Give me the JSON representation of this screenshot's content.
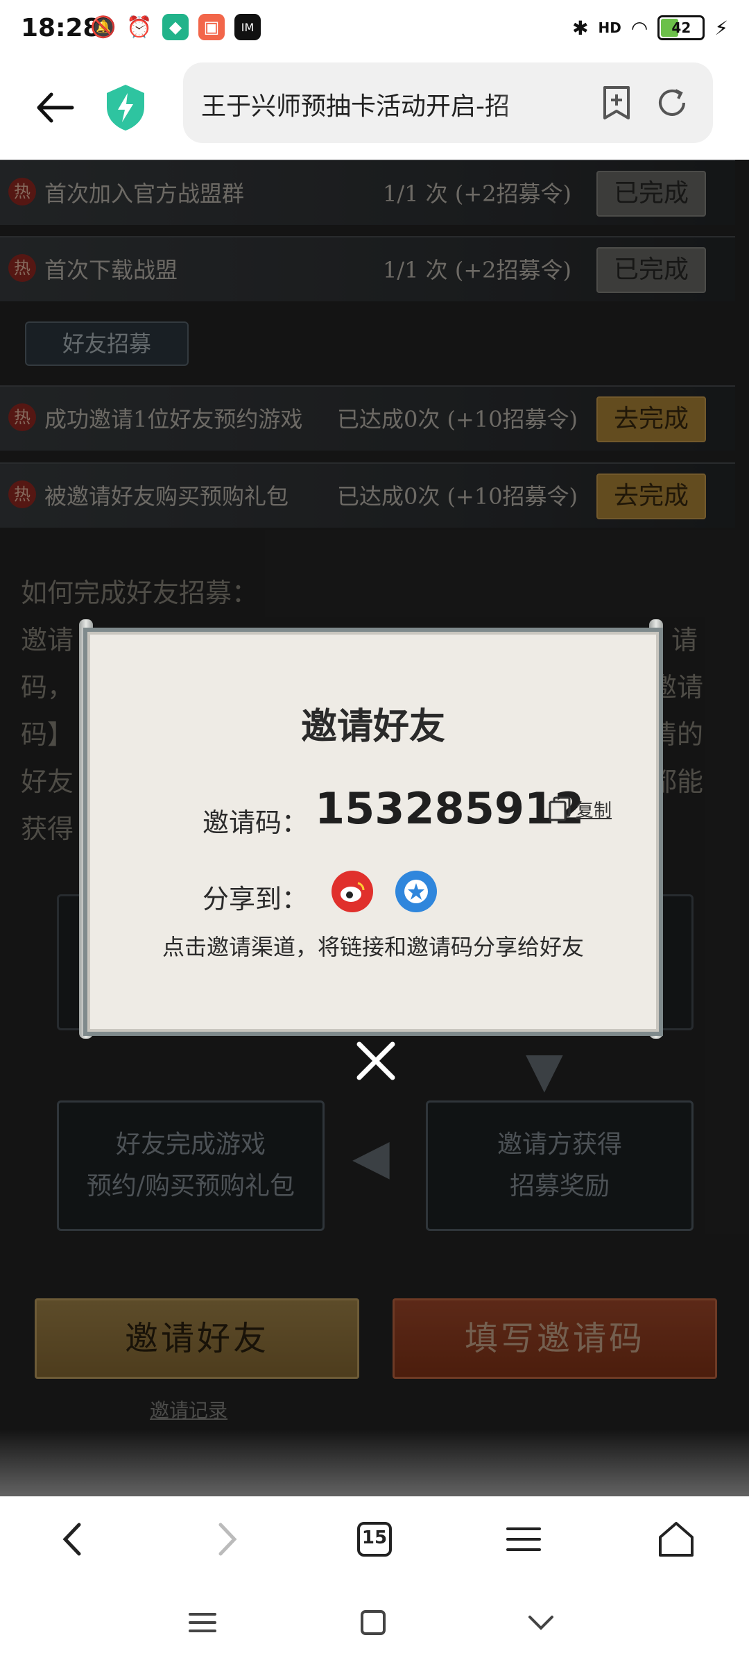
{
  "status_bar": {
    "time": "18:28",
    "battery": "42",
    "network": "HD"
  },
  "browser": {
    "url_text": "王于兴师预抽卡活动开启-招",
    "tab_count": "15"
  },
  "tasks_top": [
    {
      "name": "首次加入官方战盟群",
      "progress": "1/1 次 (+2招募令)",
      "action": "已完成"
    },
    {
      "name": "首次下载战盟",
      "progress": "1/1 次 (+2招募令)",
      "action": "已完成"
    }
  ],
  "section_friend": "好友招募",
  "tasks_friend": [
    {
      "name": "成功邀请1位好友预约游戏",
      "progress": "已达成0次 (+10招募令)",
      "action": "去完成"
    },
    {
      "name": "被邀请好友购买预购礼包",
      "progress": "已达成0次 (+10招募令)",
      "action": "去完成"
    }
  ],
  "hot_tag": "热",
  "how_to": {
    "title": "如何完成好友招募：",
    "lines": [
      "邀请",
      "码，",
      "码】",
      "好友",
      "获得"
    ],
    "right_fragments": [
      "请",
      "邀请",
      "清的",
      "都能"
    ]
  },
  "flow": {
    "box1": [
      "好友完成游戏",
      "预约/购买预购礼包"
    ],
    "box2": [
      "邀请方获得",
      "招募奖励"
    ]
  },
  "buttons": {
    "invite": "邀请好友",
    "fill_code": "填写邀请码",
    "record": "邀请记录"
  },
  "modal": {
    "title": "邀请好友",
    "code_label": "邀请码：",
    "code_value": "153285912",
    "copy_label": "复制",
    "share_label": "分享到：",
    "hint": "点击邀请渠道，将链接和邀请码分享给好友"
  },
  "colors": {
    "weibo": "#e0302c",
    "qzone": "#2f86dc",
    "accent_gold": "#b58b3a"
  }
}
